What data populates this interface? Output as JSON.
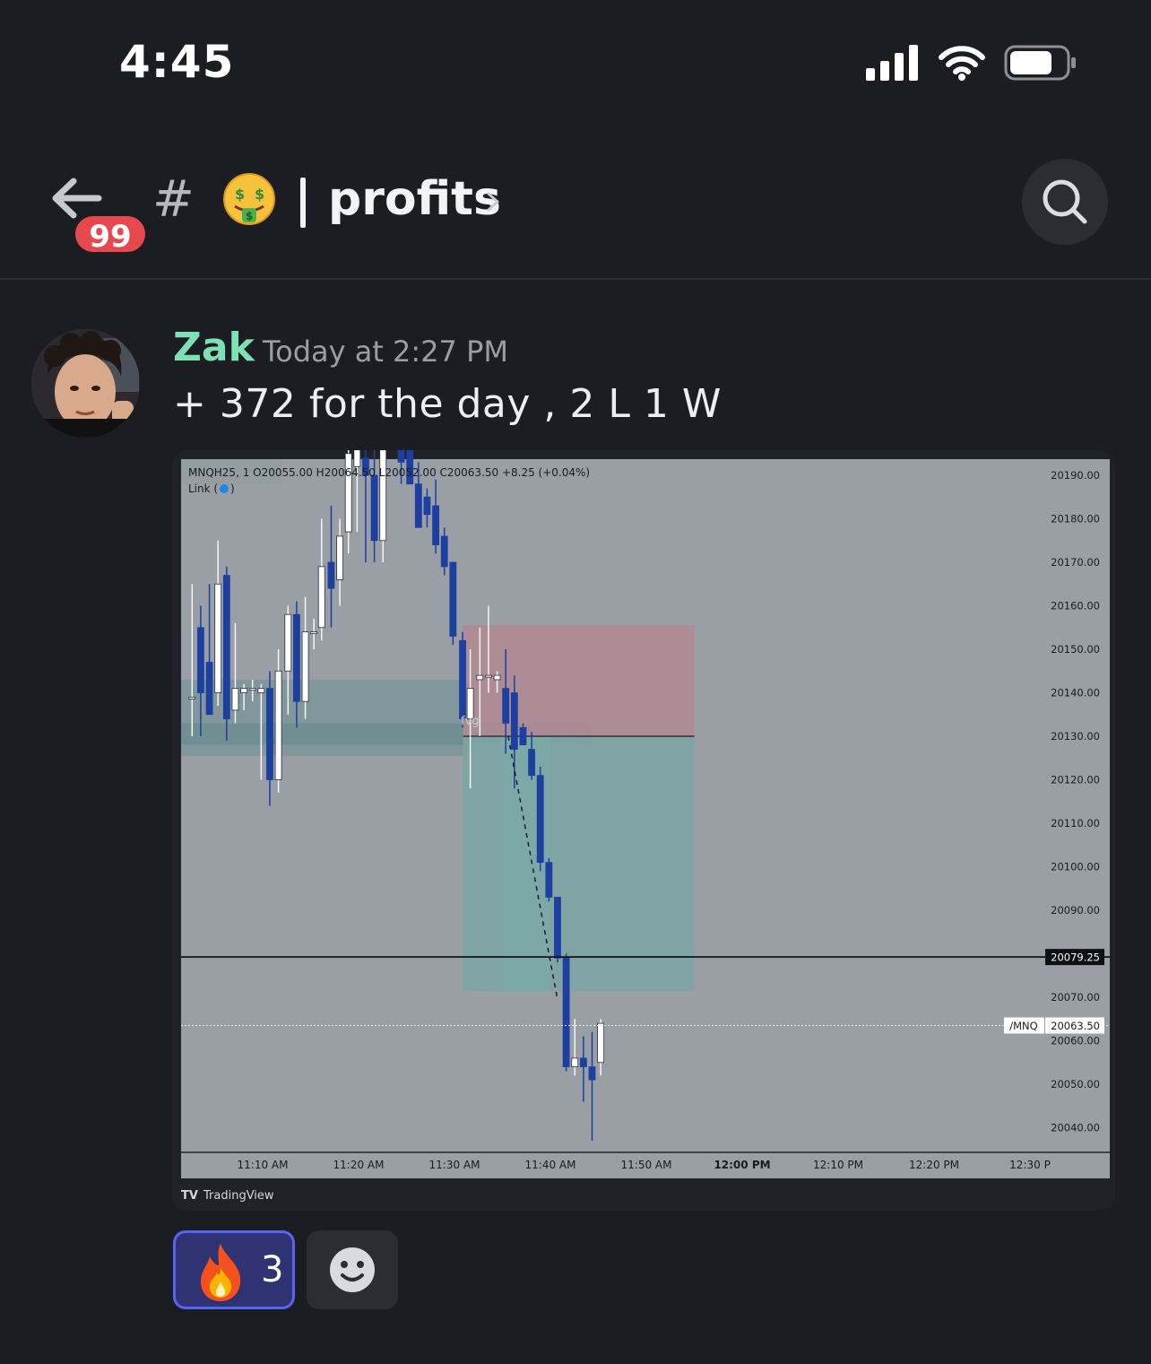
{
  "status_bar": {
    "time": "4:45"
  },
  "header": {
    "back_badge": "99",
    "hash": "#",
    "channel_name": "profits",
    "channel_emoji": "money-mouth-face"
  },
  "message": {
    "author": "Zak",
    "timestamp": "Today at 2:27 PM",
    "text": "+ 372 for the day , 2 L 1 W"
  },
  "attachment": {
    "ohlc_line": "MNQH25, 1  O20055.00  H20064.50  L20052.00  C20063.50  +8.25 (+0.04%)",
    "link_label": "Link (",
    "link_close": ")",
    "fvg_label": "fvg",
    "symbol_tag": "/MNQ",
    "watermark": "TradingView",
    "chart_data": {
      "type": "candlestick",
      "symbol": "MNQH25",
      "interval": "1",
      "ylim": [
        20033,
        20194
      ],
      "y_ticks": [
        "20190.00",
        "20180.00",
        "20170.00",
        "20160.00",
        "20150.00",
        "20140.00",
        "20130.00",
        "20120.00",
        "20110.00",
        "20100.00",
        "20090.00",
        "20070.00",
        "20060.00",
        "20050.00",
        "20040.00"
      ],
      "x_ticks": [
        "11:10 AM",
        "11:20 AM",
        "11:30 AM",
        "11:40 AM",
        "11:50 AM",
        "12:00 PM",
        "12:10 PM",
        "12:20 PM",
        "12:30 P"
      ],
      "horizontal_line": {
        "label": "20079.25",
        "value": 20079.25
      },
      "current_price": {
        "label": "20063.50",
        "value": 20063.5
      },
      "position": {
        "entry": 20130,
        "stop": 20155.5,
        "target": 20071.5
      },
      "candles": [
        {
          "x": 11.5,
          "o": 20139,
          "h": 20165,
          "l": 20130,
          "c": 20139
        },
        {
          "x": 20.5,
          "o": 20155,
          "h": 20160,
          "l": 20130,
          "c": 20140
        },
        {
          "x": 29.5,
          "o": 20147,
          "h": 20165,
          "l": 20140,
          "c": 20135
        },
        {
          "x": 38.5,
          "o": 20140,
          "h": 20175,
          "l": 20137,
          "c": 20165
        },
        {
          "x": 47.5,
          "o": 20167,
          "h": 20169,
          "l": 20129,
          "c": 20134
        },
        {
          "x": 56.5,
          "o": 20136,
          "h": 20156,
          "l": 20133,
          "c": 20141
        },
        {
          "x": 65.5,
          "o": 20140,
          "h": 20142,
          "l": 20136,
          "c": 20141
        },
        {
          "x": 74.5,
          "o": 20141,
          "h": 20143,
          "l": 20138,
          "c": 20141
        },
        {
          "x": 83.5,
          "o": 20140,
          "h": 20142,
          "l": 20120,
          "c": 20141
        },
        {
          "x": 92.5,
          "o": 20141,
          "h": 20145,
          "l": 20114,
          "c": 20120
        },
        {
          "x": 101.5,
          "o": 20120,
          "h": 20150,
          "l": 20117,
          "c": 20145
        },
        {
          "x": 111.5,
          "o": 20145,
          "h": 20160,
          "l": 20135,
          "c": 20158
        },
        {
          "x": 120.5,
          "o": 20158,
          "h": 20161,
          "l": 20132,
          "c": 20138
        },
        {
          "x": 129.5,
          "o": 20138,
          "h": 20162,
          "l": 20134,
          "c": 20154
        },
        {
          "x": 138.5,
          "o": 20154,
          "h": 20157,
          "l": 20150,
          "c": 20154
        },
        {
          "x": 146.5,
          "o": 20155,
          "h": 20180,
          "l": 20152,
          "c": 20169
        },
        {
          "x": 156.5,
          "o": 20170,
          "h": 20183,
          "l": 20155,
          "c": 20164
        },
        {
          "x": 165.5,
          "o": 20166,
          "h": 20180,
          "l": 20160,
          "c": 20176
        },
        {
          "x": 174.5,
          "o": 20177,
          "h": 20196,
          "l": 20172,
          "c": 20195
        },
        {
          "x": 183.5,
          "o": 20192,
          "h": 20196,
          "l": 20177,
          "c": 20196
        },
        {
          "x": 192.5,
          "o": 20194,
          "h": 20196,
          "l": 20170,
          "c": 20190
        },
        {
          "x": 201.5,
          "o": 20190,
          "h": 20196,
          "l": 20170,
          "c": 20175
        },
        {
          "x": 210.5,
          "o": 20175,
          "h": 20196,
          "l": 20170,
          "c": 20196
        },
        {
          "x": 229.5,
          "o": 20196,
          "h": 20197,
          "l": 20188,
          "c": 20193
        },
        {
          "x": 238.5,
          "o": 20196,
          "h": 20197,
          "l": 20190,
          "c": 20188
        },
        {
          "x": 247.5,
          "o": 20188,
          "h": 20193,
          "l": 20178,
          "c": 20178
        },
        {
          "x": 256.5,
          "o": 20185,
          "h": 20187,
          "l": 20178,
          "c": 20181
        },
        {
          "x": 265.5,
          "o": 20183,
          "h": 20189,
          "l": 20172,
          "c": 20174
        },
        {
          "x": 274.5,
          "o": 20176,
          "h": 20178,
          "l": 20167,
          "c": 20169
        },
        {
          "x": 283.5,
          "o": 20170,
          "h": 20170,
          "l": 20151,
          "c": 20153
        },
        {
          "x": 293.5,
          "o": 20152,
          "h": 20154,
          "l": 20132,
          "c": 20134
        },
        {
          "x": 301.5,
          "o": 20134,
          "h": 20150,
          "l": 20118,
          "c": 20141
        },
        {
          "x": 311.5,
          "o": 20143,
          "h": 20155,
          "l": 20130,
          "c": 20144
        },
        {
          "x": 320.5,
          "o": 20144,
          "h": 20160,
          "l": 20140,
          "c": 20144
        },
        {
          "x": 329.5,
          "o": 20143,
          "h": 20145,
          "l": 20140,
          "c": 20144
        },
        {
          "x": 338.5,
          "o": 20141,
          "h": 20150,
          "l": 20126,
          "c": 20133
        },
        {
          "x": 347.5,
          "o": 20140,
          "h": 20144,
          "l": 20118,
          "c": 20127
        },
        {
          "x": 356.5,
          "o": 20132,
          "h": 20133,
          "l": 20128,
          "c": 20128
        },
        {
          "x": 365.5,
          "o": 20127,
          "h": 20131,
          "l": 20120,
          "c": 20121
        },
        {
          "x": 374.5,
          "o": 20121,
          "h": 20123,
          "l": 20099,
          "c": 20101
        },
        {
          "x": 383.5,
          "o": 20101,
          "h": 20102,
          "l": 20092,
          "c": 20093
        },
        {
          "x": 392.5,
          "o": 20093,
          "h": 20093,
          "l": 20078,
          "c": 20079
        },
        {
          "x": 401.5,
          "o": 20079,
          "h": 20080,
          "l": 20053,
          "c": 20054
        },
        {
          "x": 410.5,
          "o": 20054,
          "h": 20065,
          "l": 20052,
          "c": 20056
        },
        {
          "x": 419.5,
          "o": 20056,
          "h": 20061,
          "l": 20046,
          "c": 20054
        },
        {
          "x": 428.5,
          "o": 20054,
          "h": 20062,
          "l": 20037,
          "c": 20051
        },
        {
          "x": 437.5,
          "o": 20055,
          "h": 20065,
          "l": 20052,
          "c": 20064
        }
      ]
    }
  },
  "reactions": [
    {
      "emoji": "fire",
      "count": "3"
    }
  ],
  "colors": {
    "background": "#1c1d22",
    "author": "#7ee0b5",
    "chart_bg": "#9a9ea5",
    "candle_down": "#1c3fa0",
    "candle_up": "#ffffff",
    "stop_zone": "#b08a93",
    "target_zone": "#7ea3a3",
    "reaction_bg": "#2f3372",
    "reaction_border": "#5865f2"
  }
}
